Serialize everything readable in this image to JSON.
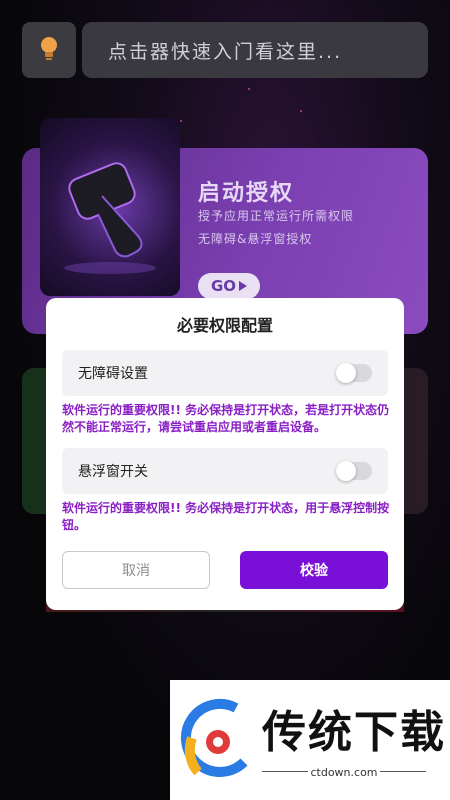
{
  "header": {
    "search_placeholder": "点击器快速入门看这里..."
  },
  "promo_card": {
    "title": "启动授权",
    "subtitle_line1": "授予应用正常运行所需权限",
    "subtitle_line2": "无障碍&悬浮窗授权",
    "go_label": "GO"
  },
  "dialog": {
    "title": "必要权限配置",
    "accessibility": {
      "label": "无障碍设置",
      "enabled": false,
      "note": "软件运行的重要权限!! 务必保持是打开状态，若是打开状态仍然不能正常运行，请尝试重启应用或者重启设备。"
    },
    "overlay": {
      "label": "悬浮窗开关",
      "enabled": false,
      "note": "软件运行的重要权限!! 务必保持是打开状态，用于悬浮控制按钮。"
    },
    "cancel_label": "取消",
    "confirm_label": "校验"
  },
  "watermark": {
    "brand": "传统下载",
    "url": "ctdown.com"
  },
  "colors": {
    "accent": "#7a10d8",
    "note_text": "#8a1fc6",
    "card_purple": "#7a3fb0"
  },
  "icons": {
    "bulb": "lightbulb-icon",
    "go_arrow": "play-triangle-icon"
  }
}
